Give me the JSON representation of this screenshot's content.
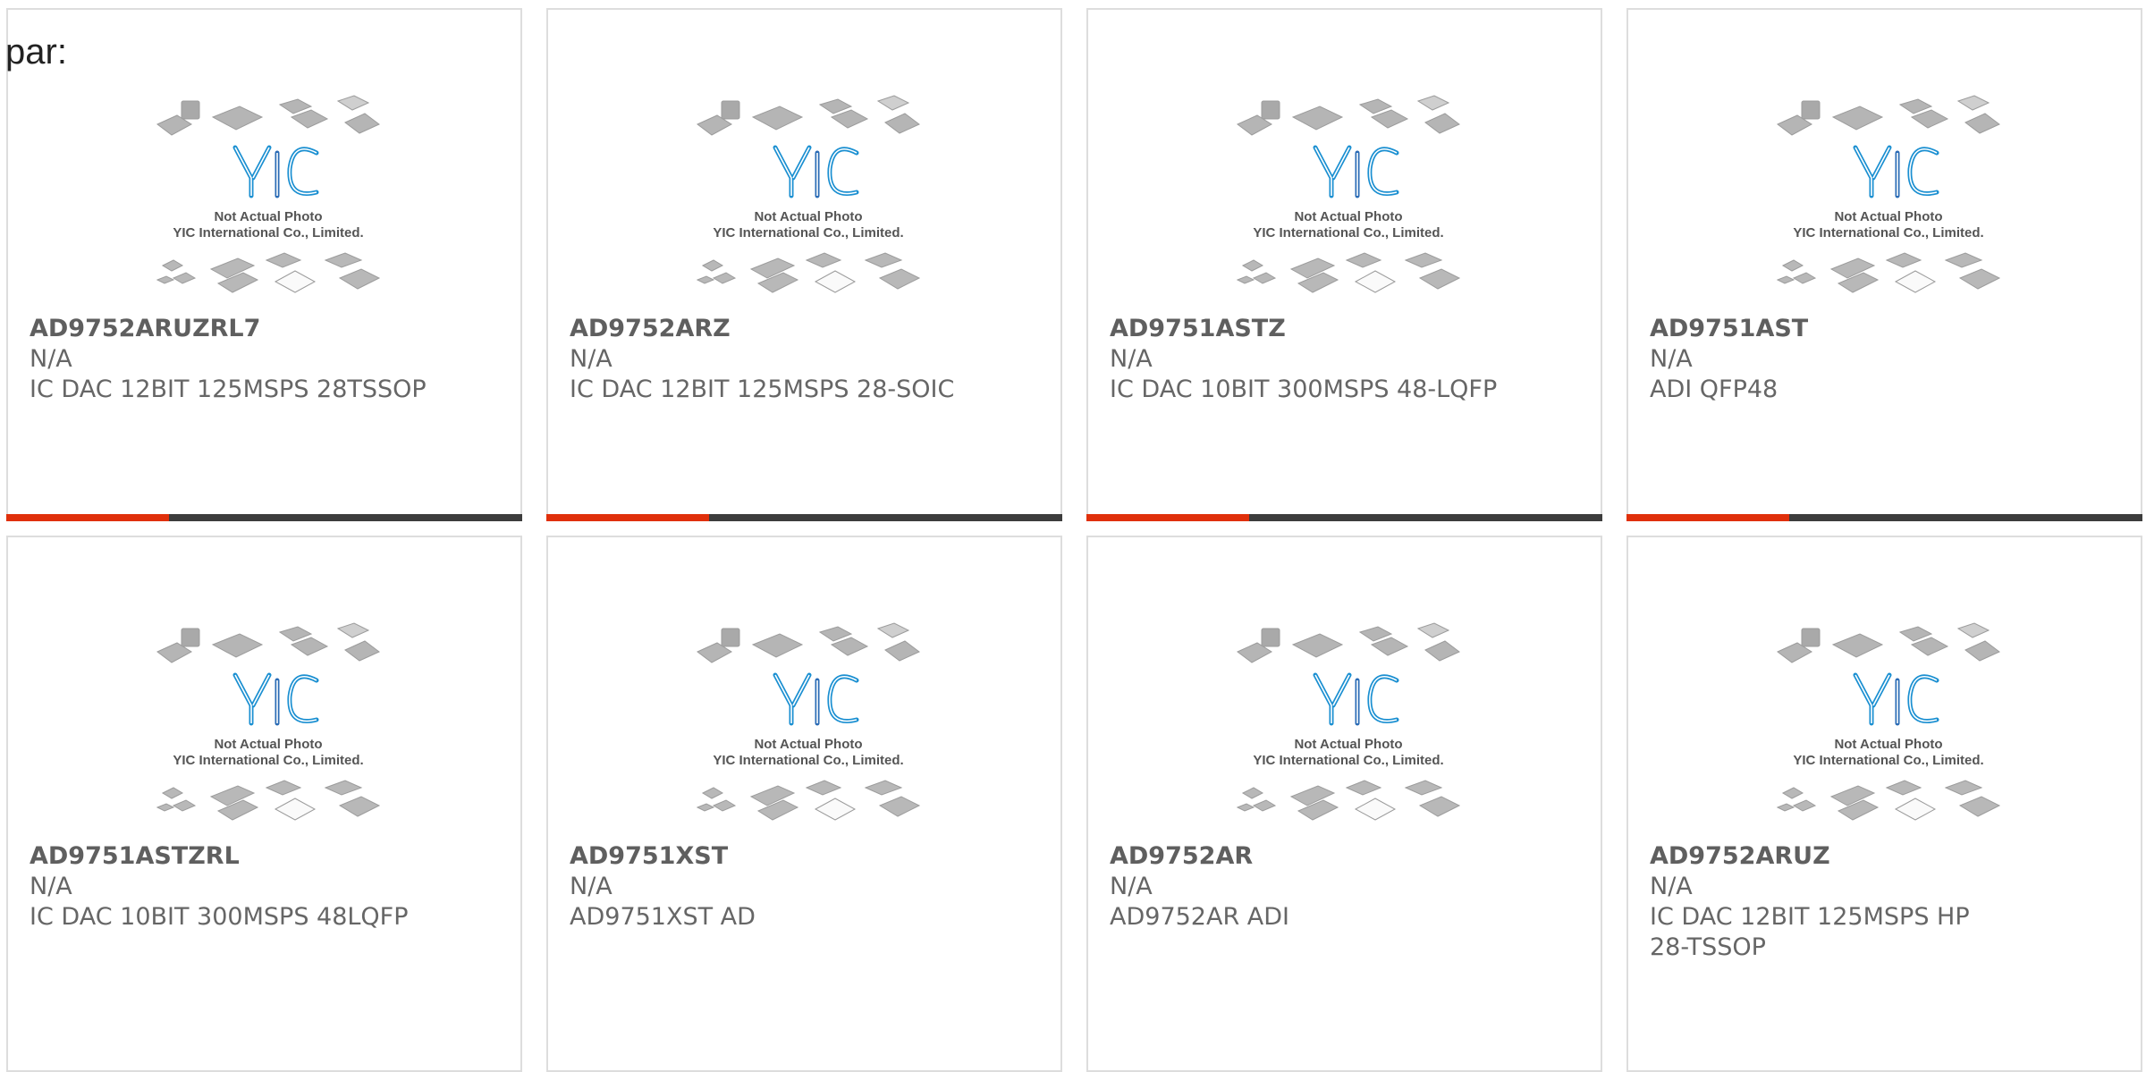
{
  "page_label": "par:",
  "photo": {
    "brand": "YIC",
    "caption_line1": "Not Actual Photo",
    "caption_line2": "YIC International Co., Limited."
  },
  "colors": {
    "accent": "#e0300b",
    "bar": "#3d3d3d",
    "logo": "#1a8fd1",
    "text": "#666666"
  },
  "products": [
    {
      "part": "AD9752ARUZRL7",
      "manufacturer": "N/A",
      "description": "IC DAC 12BIT 125MSPS 28TSSOP"
    },
    {
      "part": "AD9752ARZ",
      "manufacturer": "N/A",
      "description": "IC DAC 12BIT 125MSPS 28-SOIC"
    },
    {
      "part": "AD9751ASTZ",
      "manufacturer": "N/A",
      "description": "IC DAC 10BIT 300MSPS 48-LQFP"
    },
    {
      "part": "AD9751AST",
      "manufacturer": "N/A",
      "description": "ADI QFP48"
    },
    {
      "part": "AD9751ASTZRL",
      "manufacturer": "N/A",
      "description": "IC DAC 10BIT 300MSPS 48LQFP"
    },
    {
      "part": "AD9751XST",
      "manufacturer": "N/A",
      "description": "AD9751XST AD"
    },
    {
      "part": "AD9752AR",
      "manufacturer": "N/A",
      "description": "AD9752AR ADI"
    },
    {
      "part": "AD9752ARUZ",
      "manufacturer": "N/A",
      "description": "IC DAC 12BIT 125MSPS HP 28-TSSOP"
    }
  ]
}
